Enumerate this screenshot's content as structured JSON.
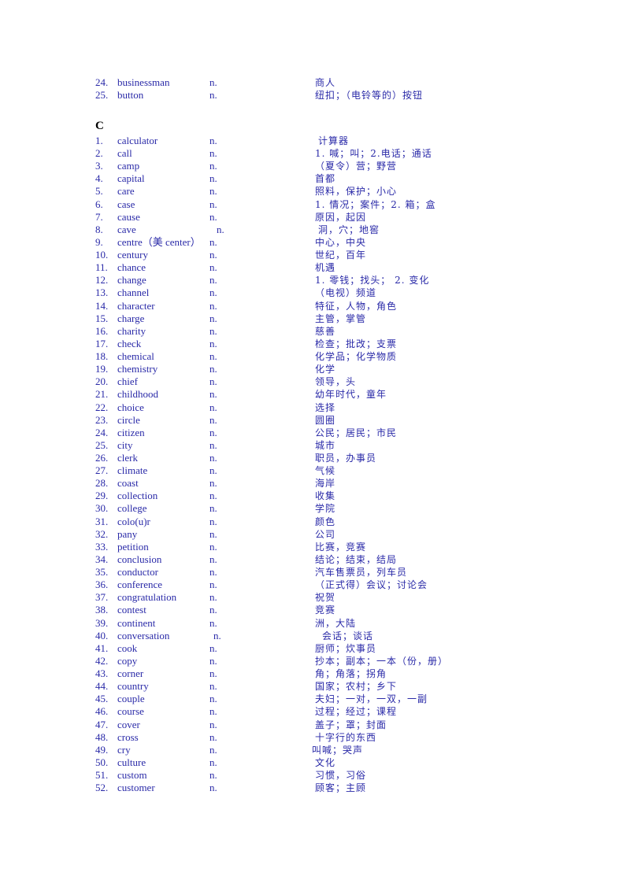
{
  "section_b_tail": [
    {
      "num": "24.",
      "word": "businessman",
      "pos": "n.",
      "meaning": "商人"
    },
    {
      "num": "25.",
      "word": "button",
      "pos": "n.",
      "meaning": "纽扣；（电铃等的）按钮"
    }
  ],
  "section_c": {
    "header": "C",
    "entries": [
      {
        "num": "1.",
        "word": "calculator",
        "pos": "n.",
        "meaning": "计算器"
      },
      {
        "num": "2.",
        "word": "call",
        "pos": "n.",
        "meaning": "1. 喊；叫；2.电话；通话"
      },
      {
        "num": "3.",
        "word": "camp",
        "pos": "n.",
        "meaning": "（夏令）营；野营"
      },
      {
        "num": "4.",
        "word": "capital",
        "pos": "n.",
        "meaning": "首都"
      },
      {
        "num": "5.",
        "word": "care",
        "pos": "n.",
        "meaning": "照料，保护；小心"
      },
      {
        "num": "6.",
        "word": "case",
        "pos": "n.",
        "meaning": "1. 情况；案件；2. 箱；盒"
      },
      {
        "num": "7.",
        "word": "cause",
        "pos": "n.",
        "meaning": "原因，起因"
      },
      {
        "num": "8.",
        "word": "cave",
        "pos": "n.",
        "meaning": "洞，穴；地窖"
      },
      {
        "num": "9.",
        "word": "centre（美 center）",
        "pos": "n.",
        "meaning": "中心，中央"
      },
      {
        "num": "10.",
        "word": "century",
        "pos": "n.",
        "meaning": "世纪，百年"
      },
      {
        "num": "11.",
        "word": "chance",
        "pos": "n.",
        "meaning": "机遇"
      },
      {
        "num": "12.",
        "word": "change",
        "pos": "n.",
        "meaning": "1. 零钱；找头；  2. 变化"
      },
      {
        "num": "13.",
        "word": "channel",
        "pos": "n.",
        "meaning": "（电视）频道"
      },
      {
        "num": "14.",
        "word": "character",
        "pos": "n.",
        "meaning": "特征，人物，角色"
      },
      {
        "num": "15.",
        "word": "charge",
        "pos": "n.",
        "meaning": "主管，掌管"
      },
      {
        "num": "16.",
        "word": "charity",
        "pos": "n.",
        "meaning": "慈善"
      },
      {
        "num": "17.",
        "word": "check",
        "pos": "n.",
        "meaning": "检查；批改；支票"
      },
      {
        "num": "18.",
        "word": "chemical",
        "pos": "n.",
        "meaning": "化学品；化学物质"
      },
      {
        "num": "19.",
        "word": "chemistry",
        "pos": "n.",
        "meaning": "化学"
      },
      {
        "num": "20.",
        "word": "chief",
        "pos": "n.",
        "meaning": "领导，头"
      },
      {
        "num": "21.",
        "word": "childhood",
        "pos": "n.",
        "meaning": "幼年时代，童年"
      },
      {
        "num": "22.",
        "word": "choice",
        "pos": "n.",
        "meaning": "选择"
      },
      {
        "num": "23.",
        "word": "circle",
        "pos": "n.",
        "meaning": "圆圈"
      },
      {
        "num": "24.",
        "word": "citizen",
        "pos": "n.",
        "meaning": "公民；居民；市民"
      },
      {
        "num": "25.",
        "word": "city",
        "pos": "n.",
        "meaning": "城市"
      },
      {
        "num": "26.",
        "word": "clerk",
        "pos": "n.",
        "meaning": "职员，办事员"
      },
      {
        "num": "27.",
        "word": "climate",
        "pos": "n.",
        "meaning": "气候"
      },
      {
        "num": "28.",
        "word": "coast",
        "pos": "n.",
        "meaning": "海岸"
      },
      {
        "num": "29.",
        "word": "collection",
        "pos": "n.",
        "meaning": "收集"
      },
      {
        "num": "30.",
        "word": "college",
        "pos": "n.",
        "meaning": "学院"
      },
      {
        "num": "31.",
        "word": "colo(u)r",
        "pos": "n.",
        "meaning": "颜色"
      },
      {
        "num": "32.",
        "word": "pany",
        "pos": "n.",
        "meaning": "公司"
      },
      {
        "num": "33.",
        "word": "petition",
        "pos": "n.",
        "meaning": "比赛，竞赛"
      },
      {
        "num": "34.",
        "word": "conclusion",
        "pos": "n.",
        "meaning": "结论；结束，结局"
      },
      {
        "num": "35.",
        "word": "conductor",
        "pos": "n.",
        "meaning": "汽车售票员，列车员"
      },
      {
        "num": "36.",
        "word": "conference",
        "pos": "n.",
        "meaning": "（正式得）会议；讨论会"
      },
      {
        "num": "37.",
        "word": "congratulation",
        "pos": "n.",
        "meaning": "祝贺"
      },
      {
        "num": "38.",
        "word": "contest",
        "pos": "n.",
        "meaning": "竞赛"
      },
      {
        "num": "39.",
        "word": "continent",
        "pos": "n.",
        "meaning": "洲，大陆"
      },
      {
        "num": "40.",
        "word": "conversation",
        "pos": "n.",
        "meaning": "会话；谈话"
      },
      {
        "num": "41.",
        "word": "cook",
        "pos": "n.",
        "meaning": "厨师；炊事员"
      },
      {
        "num": "42.",
        "word": "copy",
        "pos": "n.",
        "meaning": "抄本；副本；一本（份，册）"
      },
      {
        "num": "43.",
        "word": "corner",
        "pos": "n.",
        "meaning": "角；角落；拐角"
      },
      {
        "num": "44.",
        "word": "country",
        "pos": "n.",
        "meaning": "国家；农村；乡下"
      },
      {
        "num": "45.",
        "word": "couple",
        "pos": "n.",
        "meaning": "夫妇；一对，一双，一副"
      },
      {
        "num": "46.",
        "word": "course",
        "pos": "n.",
        "meaning": "过程；经过；课程"
      },
      {
        "num": "47.",
        "word": "cover",
        "pos": "n.",
        "meaning": "盖子；罩；封面"
      },
      {
        "num": "48.",
        "word": "cross",
        "pos": "n.",
        "meaning": "十字行的东西"
      },
      {
        "num": "49.",
        "word": "cry",
        "pos": "n.",
        "meaning": "叫喊；哭声"
      },
      {
        "num": "50.",
        "word": "culture",
        "pos": "n.",
        "meaning": "文化"
      },
      {
        "num": "51.",
        "word": "custom",
        "pos": "n.",
        "meaning": "习惯，习俗"
      },
      {
        "num": "52.",
        "word": "customer",
        "pos": "n.",
        "meaning": "顾客；主顾"
      }
    ]
  }
}
